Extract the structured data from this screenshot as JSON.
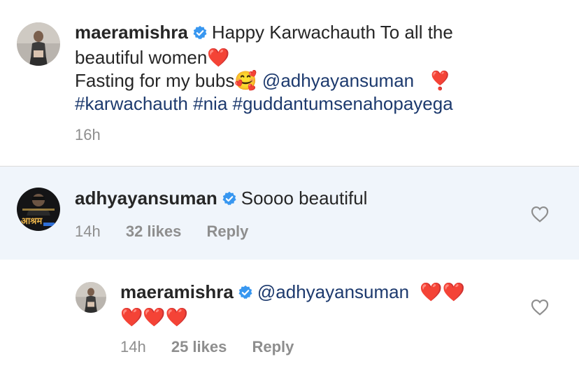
{
  "caption": {
    "username": "maeramishra",
    "line1": "Happy Karwachauth To all the",
    "line2": "beautiful women",
    "heart1": "❤️",
    "line3": "Fasting for my bubs",
    "emoji_smile": "🥰",
    "mention": "@adhyayansuman",
    "emoji_exclaim": "❣️",
    "hashtags": [
      "#karwachauth",
      "#nia",
      "#guddantumsenahopayega"
    ],
    "time": "16h"
  },
  "comment": {
    "username": "adhyayansuman",
    "text": "Soooo beautiful",
    "avatar_text": "आश्रम",
    "time": "14h",
    "likes": "32 likes",
    "reply": "Reply"
  },
  "reply": {
    "username": "maeramishra",
    "mention": "@adhyayansuman",
    "hearts_line1": "❤️❤️",
    "hearts_line2": "❤️❤️❤️",
    "time": "14h",
    "likes": "25 likes",
    "reply": "Reply"
  },
  "colors": {
    "verified": "#3897f0",
    "mention": "#1d3a6e",
    "meta": "#8e8e8e",
    "highlight": "#f0f5fb"
  },
  "icons": [
    "verified-badge-icon",
    "heart-outline-icon"
  ]
}
